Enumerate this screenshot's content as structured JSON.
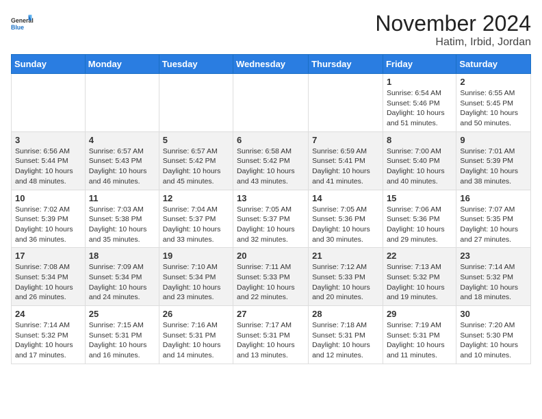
{
  "header": {
    "logo_general": "General",
    "logo_blue": "Blue",
    "month_title": "November 2024",
    "location": "Hatim, Irbid, Jordan"
  },
  "weekdays": [
    "Sunday",
    "Monday",
    "Tuesday",
    "Wednesday",
    "Thursday",
    "Friday",
    "Saturday"
  ],
  "weeks": [
    {
      "id": "week1",
      "days": [
        {
          "num": "",
          "info": ""
        },
        {
          "num": "",
          "info": ""
        },
        {
          "num": "",
          "info": ""
        },
        {
          "num": "",
          "info": ""
        },
        {
          "num": "",
          "info": ""
        },
        {
          "num": "1",
          "info": "Sunrise: 6:54 AM\nSunset: 5:46 PM\nDaylight: 10 hours\nand 51 minutes."
        },
        {
          "num": "2",
          "info": "Sunrise: 6:55 AM\nSunset: 5:45 PM\nDaylight: 10 hours\nand 50 minutes."
        }
      ]
    },
    {
      "id": "week2",
      "days": [
        {
          "num": "3",
          "info": "Sunrise: 6:56 AM\nSunset: 5:44 PM\nDaylight: 10 hours\nand 48 minutes."
        },
        {
          "num": "4",
          "info": "Sunrise: 6:57 AM\nSunset: 5:43 PM\nDaylight: 10 hours\nand 46 minutes."
        },
        {
          "num": "5",
          "info": "Sunrise: 6:57 AM\nSunset: 5:42 PM\nDaylight: 10 hours\nand 45 minutes."
        },
        {
          "num": "6",
          "info": "Sunrise: 6:58 AM\nSunset: 5:42 PM\nDaylight: 10 hours\nand 43 minutes."
        },
        {
          "num": "7",
          "info": "Sunrise: 6:59 AM\nSunset: 5:41 PM\nDaylight: 10 hours\nand 41 minutes."
        },
        {
          "num": "8",
          "info": "Sunrise: 7:00 AM\nSunset: 5:40 PM\nDaylight: 10 hours\nand 40 minutes."
        },
        {
          "num": "9",
          "info": "Sunrise: 7:01 AM\nSunset: 5:39 PM\nDaylight: 10 hours\nand 38 minutes."
        }
      ]
    },
    {
      "id": "week3",
      "days": [
        {
          "num": "10",
          "info": "Sunrise: 7:02 AM\nSunset: 5:39 PM\nDaylight: 10 hours\nand 36 minutes."
        },
        {
          "num": "11",
          "info": "Sunrise: 7:03 AM\nSunset: 5:38 PM\nDaylight: 10 hours\nand 35 minutes."
        },
        {
          "num": "12",
          "info": "Sunrise: 7:04 AM\nSunset: 5:37 PM\nDaylight: 10 hours\nand 33 minutes."
        },
        {
          "num": "13",
          "info": "Sunrise: 7:05 AM\nSunset: 5:37 PM\nDaylight: 10 hours\nand 32 minutes."
        },
        {
          "num": "14",
          "info": "Sunrise: 7:05 AM\nSunset: 5:36 PM\nDaylight: 10 hours\nand 30 minutes."
        },
        {
          "num": "15",
          "info": "Sunrise: 7:06 AM\nSunset: 5:36 PM\nDaylight: 10 hours\nand 29 minutes."
        },
        {
          "num": "16",
          "info": "Sunrise: 7:07 AM\nSunset: 5:35 PM\nDaylight: 10 hours\nand 27 minutes."
        }
      ]
    },
    {
      "id": "week4",
      "days": [
        {
          "num": "17",
          "info": "Sunrise: 7:08 AM\nSunset: 5:34 PM\nDaylight: 10 hours\nand 26 minutes."
        },
        {
          "num": "18",
          "info": "Sunrise: 7:09 AM\nSunset: 5:34 PM\nDaylight: 10 hours\nand 24 minutes."
        },
        {
          "num": "19",
          "info": "Sunrise: 7:10 AM\nSunset: 5:34 PM\nDaylight: 10 hours\nand 23 minutes."
        },
        {
          "num": "20",
          "info": "Sunrise: 7:11 AM\nSunset: 5:33 PM\nDaylight: 10 hours\nand 22 minutes."
        },
        {
          "num": "21",
          "info": "Sunrise: 7:12 AM\nSunset: 5:33 PM\nDaylight: 10 hours\nand 20 minutes."
        },
        {
          "num": "22",
          "info": "Sunrise: 7:13 AM\nSunset: 5:32 PM\nDaylight: 10 hours\nand 19 minutes."
        },
        {
          "num": "23",
          "info": "Sunrise: 7:14 AM\nSunset: 5:32 PM\nDaylight: 10 hours\nand 18 minutes."
        }
      ]
    },
    {
      "id": "week5",
      "days": [
        {
          "num": "24",
          "info": "Sunrise: 7:14 AM\nSunset: 5:32 PM\nDaylight: 10 hours\nand 17 minutes."
        },
        {
          "num": "25",
          "info": "Sunrise: 7:15 AM\nSunset: 5:31 PM\nDaylight: 10 hours\nand 16 minutes."
        },
        {
          "num": "26",
          "info": "Sunrise: 7:16 AM\nSunset: 5:31 PM\nDaylight: 10 hours\nand 14 minutes."
        },
        {
          "num": "27",
          "info": "Sunrise: 7:17 AM\nSunset: 5:31 PM\nDaylight: 10 hours\nand 13 minutes."
        },
        {
          "num": "28",
          "info": "Sunrise: 7:18 AM\nSunset: 5:31 PM\nDaylight: 10 hours\nand 12 minutes."
        },
        {
          "num": "29",
          "info": "Sunrise: 7:19 AM\nSunset: 5:31 PM\nDaylight: 10 hours\nand 11 minutes."
        },
        {
          "num": "30",
          "info": "Sunrise: 7:20 AM\nSunset: 5:30 PM\nDaylight: 10 hours\nand 10 minutes."
        }
      ]
    }
  ]
}
